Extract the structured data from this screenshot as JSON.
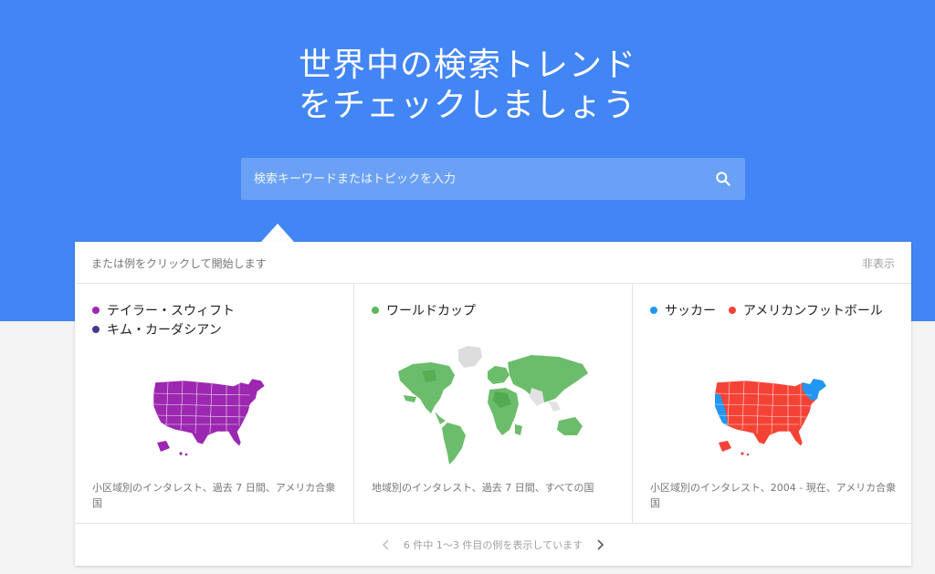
{
  "hero": {
    "title_line1": "世界中の検索トレンド",
    "title_line2": "をチェックしましょう",
    "bg_color": "#4285f4"
  },
  "search": {
    "placeholder": "検索キーワードまたはトピックを入力",
    "icon": "search-icon"
  },
  "examples_panel": {
    "hint": "または例をクリックして開始します",
    "hide_label": "非表示",
    "cards": [
      {
        "legend": [
          {
            "label": "テイラー・スウィフト",
            "color": "#9c27b0"
          },
          {
            "label": "キム・カーダシアン",
            "color": "#3f3d8f"
          }
        ],
        "map": "us-map",
        "caption": "小区域別のインタレスト、過去 7 日間、アメリカ合衆国"
      },
      {
        "legend": [
          {
            "label": "ワールドカップ",
            "color": "#5cb85c"
          }
        ],
        "map": "world-map",
        "caption": "地域別のインタレスト、過去 7 日間、すべての国"
      },
      {
        "legend": [
          {
            "label": "サッカー",
            "color": "#2196f3"
          },
          {
            "label": "アメリカンフットボール",
            "color": "#f44336"
          }
        ],
        "map": "us-map",
        "caption": "小区域別のインタレスト、2004 - 現在、アメリカ合衆国"
      }
    ],
    "pager_text": "6 件中 1～3 件目の例を表示しています",
    "prev_icon": "chevron-left-icon",
    "next_icon": "chevron-right-icon"
  }
}
